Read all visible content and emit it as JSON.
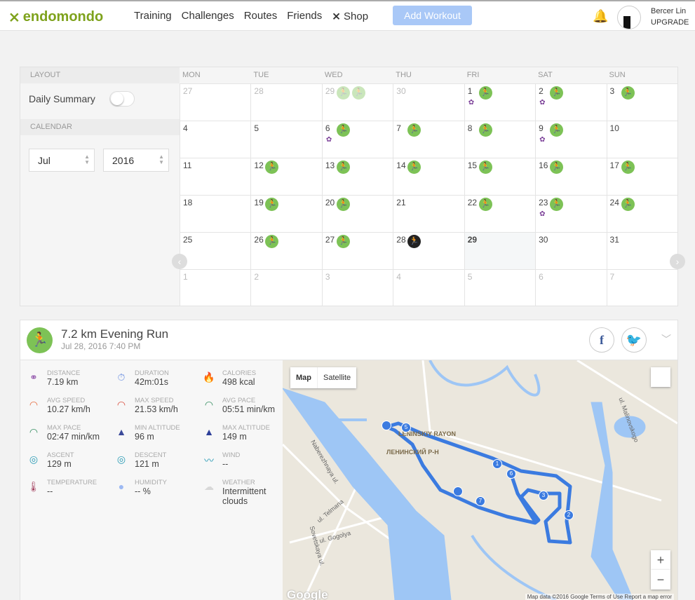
{
  "header": {
    "brand": "endomondo",
    "nav": [
      "Training",
      "Challenges",
      "Routes",
      "Friends",
      "Shop"
    ],
    "add_workout": "Add Workout",
    "user_name": "Bercer Lin",
    "upgrade": "UPGRADE"
  },
  "sidebar": {
    "layout_label": "LAYOUT",
    "daily_summary": "Daily Summary",
    "daily_summary_on": false,
    "calendar_label": "CALENDAR",
    "month": "Jul",
    "year": "2016"
  },
  "calendar": {
    "weekdays": [
      "MON",
      "TUE",
      "WED",
      "THU",
      "FRI",
      "SAT",
      "SUN"
    ],
    "weeks": [
      [
        {
          "d": "27",
          "o": 1
        },
        {
          "d": "28",
          "o": 1
        },
        {
          "d": "29",
          "o": 1,
          "w": 2,
          "f": 1
        },
        {
          "d": "30",
          "o": 1
        },
        {
          "d": "1",
          "w": 1,
          "b": 1
        },
        {
          "d": "2",
          "w": 1,
          "b": 1
        },
        {
          "d": "3",
          "w": 1
        }
      ],
      [
        {
          "d": "4"
        },
        {
          "d": "5"
        },
        {
          "d": "6",
          "w": 1,
          "b": 1
        },
        {
          "d": "7",
          "w": 1
        },
        {
          "d": "8",
          "w": 1
        },
        {
          "d": "9",
          "w": 1,
          "b": 1
        },
        {
          "d": "10"
        }
      ],
      [
        {
          "d": "11"
        },
        {
          "d": "12",
          "w": 1
        },
        {
          "d": "13",
          "w": 1
        },
        {
          "d": "14",
          "w": 1
        },
        {
          "d": "15",
          "w": 1
        },
        {
          "d": "16",
          "w": 1
        },
        {
          "d": "17",
          "w": 1
        }
      ],
      [
        {
          "d": "18"
        },
        {
          "d": "19",
          "w": 1
        },
        {
          "d": "20",
          "w": 1
        },
        {
          "d": "21"
        },
        {
          "d": "22",
          "w": 1
        },
        {
          "d": "23",
          "w": 1,
          "b": 1
        },
        {
          "d": "24",
          "w": 1
        }
      ],
      [
        {
          "d": "25"
        },
        {
          "d": "26",
          "w": 1
        },
        {
          "d": "27",
          "w": 1
        },
        {
          "d": "28",
          "w": 1,
          "k": 1
        },
        {
          "d": "29",
          "t": 1
        },
        {
          "d": "30"
        },
        {
          "d": "31"
        }
      ],
      [
        {
          "d": "1",
          "o": 1
        },
        {
          "d": "2",
          "o": 1
        },
        {
          "d": "3",
          "o": 1
        },
        {
          "d": "4",
          "o": 1
        },
        {
          "d": "5",
          "o": 1
        },
        {
          "d": "6",
          "o": 1
        },
        {
          "d": "7",
          "o": 1
        }
      ]
    ]
  },
  "activity": {
    "title": "7.2 km Evening Run",
    "date": "Jul 28, 2016 7:40 PM",
    "stats": [
      {
        "label": "DISTANCE",
        "value": "7.19 km",
        "icon": "distance-icon",
        "color": "#8e4fa8"
      },
      {
        "label": "DURATION",
        "value": "42m:01s",
        "icon": "stopwatch-icon",
        "color": "#6b8fe0"
      },
      {
        "label": "CALORIES",
        "value": "498 kcal",
        "icon": "flame-icon",
        "color": "#ee6b3b"
      },
      {
        "label": "AVG SPEED",
        "value": "10.27 km/h",
        "icon": "speedometer-icon",
        "color": "#e5673a"
      },
      {
        "label": "MAX SPEED",
        "value": "21.53 km/h",
        "icon": "speedometer-icon",
        "color": "#d84a3a"
      },
      {
        "label": "AVG PACE",
        "value": "05:51 min/km",
        "icon": "pace-icon",
        "color": "#2e8a5b"
      },
      {
        "label": "MAX PACE",
        "value": "02:47 min/km",
        "icon": "pace-icon",
        "color": "#2e8a5b"
      },
      {
        "label": "MIN ALTITUDE",
        "value": "96 m",
        "icon": "mountain-icon",
        "color": "#3b4a9a"
      },
      {
        "label": "MAX ALTITUDE",
        "value": "149 m",
        "icon": "mountain-icon",
        "color": "#2d3f99"
      },
      {
        "label": "ASCENT",
        "value": "129 m",
        "icon": "ascent-icon",
        "color": "#2a9bb5"
      },
      {
        "label": "DESCENT",
        "value": "121 m",
        "icon": "descent-icon",
        "color": "#2a9bb5"
      },
      {
        "label": "WIND",
        "value": "--",
        "icon": "wind-icon",
        "color": "#2a9bb5"
      },
      {
        "label": "TEMPERATURE",
        "value": "--",
        "icon": "thermometer-icon",
        "color": "#a3415f"
      },
      {
        "label": "HUMIDITY",
        "value": "-- %",
        "icon": "humidity-icon",
        "color": "#9db9f3"
      },
      {
        "label": "WEATHER",
        "value": "Intermittent clouds",
        "icon": "weather-icon",
        "color": "#d8d8d8"
      }
    ]
  },
  "map": {
    "map_tab": "Map",
    "satellite_tab": "Satellite",
    "zoom_in": "+",
    "zoom_out": "−",
    "google": "Google",
    "footer": "Map data ©2016 Google   Terms of Use   Report a map error",
    "labels": [
      "LENINSKIY RAYON",
      "ЛЕНИНСКИЙ Р-Н",
      "Naberezhnaya ul.",
      "ul. Telmana",
      "ul. Gogolya",
      "Sovetskaya ul.",
      "ul. Malinovskogo"
    ],
    "markers": [
      "5",
      "1",
      "6",
      "3",
      "2",
      "7"
    ]
  },
  "colors": {
    "brand": "#7ea21c",
    "workout": "#7dc256",
    "route": "#3b7be0",
    "water": "#9ec6f5"
  }
}
